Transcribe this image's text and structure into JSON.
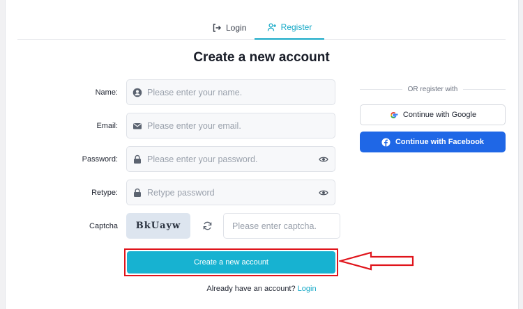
{
  "tabs": {
    "login_label": "Login",
    "register_label": "Register",
    "active": "register"
  },
  "form": {
    "title": "Create a new account",
    "name_label": "Name:",
    "name_placeholder": "Please enter your name.",
    "email_label": "Email:",
    "email_placeholder": "Please enter your email.",
    "password_label": "Password:",
    "password_placeholder": "Please enter your password.",
    "retype_label": "Retype:",
    "retype_placeholder": "Retype password",
    "captcha_label": "Captcha",
    "captcha_code": "BkUayw",
    "captcha_placeholder": "Please enter captcha.",
    "submit_label": "Create a new account",
    "already_text": "Already have an account?",
    "login_link": "Login"
  },
  "social": {
    "or_text": "OR register with",
    "google_label": "Continue with Google",
    "facebook_label": "Continue with Facebook"
  },
  "icons": {
    "login": "login-icon",
    "register": "user-plus-icon",
    "name": "user-circle-icon",
    "email": "envelope-icon",
    "password": "lock-icon",
    "eye": "eye-icon",
    "refresh": "refresh-icon",
    "google": "google-icon",
    "facebook": "facebook-icon"
  },
  "colors": {
    "accent": "#17b2d1",
    "facebook": "#1f67e6",
    "annotation": "#e0141b"
  }
}
